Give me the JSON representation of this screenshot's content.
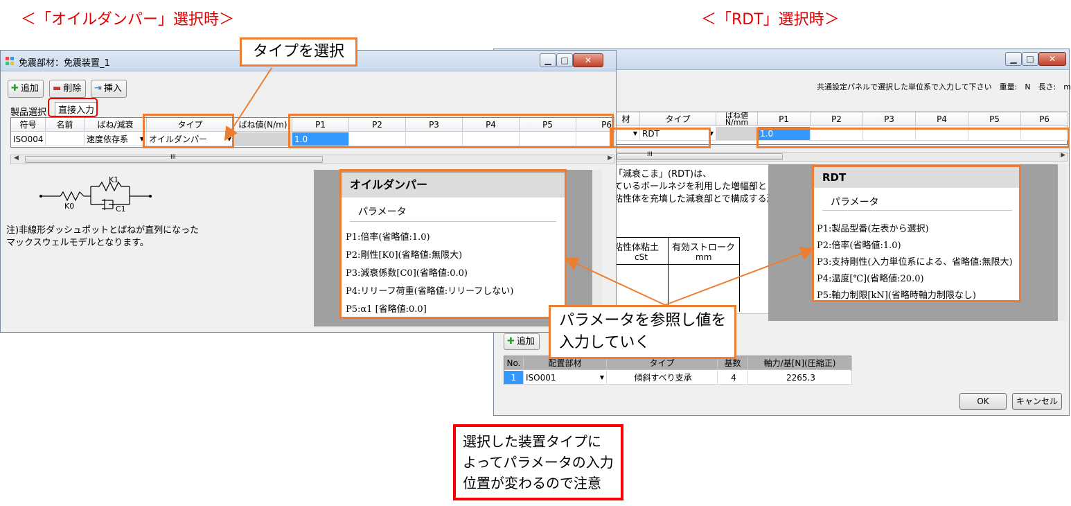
{
  "headings": {
    "left": "＜「オイルダンパー」選択時＞",
    "right": "＜「RDT」選択時＞"
  },
  "left_window": {
    "title": "免震部材：免震装置_1",
    "toolbar": {
      "add": "追加",
      "delete": "削除",
      "insert": "挿入"
    },
    "tabs": {
      "product": "製品選択",
      "direct": "直接入力"
    },
    "columns": [
      "符号",
      "名前",
      "ばね/減衰",
      "タイプ",
      "ばね値(N/m)",
      "P1",
      "P2",
      "P3",
      "P4",
      "P5",
      "P6"
    ],
    "row": {
      "code": "ISO004",
      "name": "",
      "spring": "速度依存系",
      "type": "オイルダンパー",
      "spring_value": "",
      "p1": "1.0"
    },
    "scroll_mark": "III",
    "model": {
      "k1": "K1",
      "k0": "K0",
      "c1": "C1",
      "note_line1": "注)非線形ダッシュポットとばねが直列になった",
      "note_line2": "マックスウェルモデルとなります。"
    },
    "params": {
      "title": "オイルダンパー",
      "subtitle": "パラメータ",
      "lines": [
        "P1:倍率(省略値:1.0)",
        "P2:剛性[K0](省略値:無限大)",
        "P3:減衰係数[C0](省略値:0.0)",
        "P4:リリーフ荷重(省略値:リリーフしない)",
        "P5:α1 [省略値:0.0]"
      ]
    }
  },
  "right_window": {
    "unit_notice": "共通設定パネルで選択した単位系で入力して下さい　重量:　N　長さ:　mm",
    "columns": [
      "材",
      "タイプ",
      "ばね値\nN/mm",
      "P1",
      "P2",
      "P3",
      "P4",
      "P5",
      "P6"
    ],
    "row": {
      "type": "RDT",
      "p1": "1.0"
    },
    "scroll_mark": "III",
    "desc_lines": [
      "「減衰こま」(RDT)は、",
      "ているボールネジを利用した増幅部と",
      "粘性体を充填した減衰部とで構成する減"
    ],
    "table": {
      "h1": "粘性体粘土",
      "h2": "有効ストローク",
      "u1": "cSt",
      "u2": "mm"
    },
    "params": {
      "title": "RDT",
      "subtitle": "パラメータ",
      "lines": [
        "P1:製品型番(左表から選択)",
        "P2:倍率(省略値:1.0)",
        "P3:支持剛性(入力単位系による、省略値:無限大)",
        "P4:温度[℃](省略値:20.0)",
        "P5:軸力制限[kN](省略時軸力制限なし)"
      ]
    },
    "bottom": {
      "add": "追加",
      "columns": [
        "No.",
        "配置部材",
        "タイプ",
        "基数",
        "軸力/基[N](圧縮正)"
      ],
      "row": {
        "no": "1",
        "member": "ISO001",
        "type": "傾斜すべり支承",
        "count": "4",
        "force": "2265.3"
      },
      "ok": "OK",
      "cancel": "キャンセル"
    }
  },
  "callouts": {
    "type_select": "タイプを選択",
    "param_line1": "パラメータを参照し値を",
    "param_line2": "入力していく"
  },
  "note": {
    "line1": "選択した装置タイプに",
    "line2": "よってパラメータの入力",
    "line3": "位置が変わるので注意"
  },
  "colors": {
    "accent_orange": "#ed7d31",
    "warning_red": "#ff0000",
    "selection_blue": "#3399ff"
  }
}
